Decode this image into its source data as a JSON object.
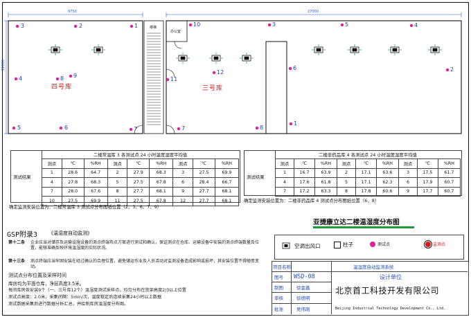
{
  "dimensions": {
    "left_width": "9750",
    "right_width": "27000",
    "height": "12000"
  },
  "rooms": {
    "room4": "四号库",
    "room3": "三号库",
    "stairs": "楼梯",
    "office": "办公室"
  },
  "points": [
    "3",
    "2",
    "1",
    "4",
    "8",
    "9",
    "5",
    "6",
    "7",
    "10",
    "3",
    "5",
    "4",
    "6",
    "11",
    "12",
    "2",
    "1",
    "8",
    "7"
  ],
  "table1": {
    "caption": "二楼常温库 3 各测试点 24 小时温度湿度平均值",
    "row_header": "测试结果",
    "headers": [
      "测点",
      "℃",
      "%RH",
      "测点",
      "℃",
      "%RH",
      "测点",
      "℃",
      "%RH"
    ],
    "rows": [
      [
        "1",
        "28.6",
        "64.7",
        "2",
        "27.9",
        "68.3",
        "3",
        "27.5",
        "69.9"
      ],
      [
        "4",
        "27.8",
        "68.3",
        "5",
        "27.5",
        "67.8",
        "6",
        "28.4",
        "66.7"
      ],
      [
        "7",
        "28.0",
        "67.6",
        "8",
        "27.7",
        "68.1",
        "9",
        "27.7",
        "68.1"
      ],
      [
        "10",
        "27.5",
        "69.9",
        "11",
        "27.5",
        "67.8",
        "12",
        "27.7",
        "68.1"
      ]
    ],
    "note": "确定监测安装位置为：二楼常温库 3 测试点分布图纸位置（2、3、6、7、9）"
  },
  "table2": {
    "caption": "二楼非药品库 4 各测试点 24 小时温度湿度平均值",
    "row_header": "测试结果",
    "headers": [
      "测点",
      "℃",
      "%RH",
      "测点",
      "℃",
      "%RH",
      "测点",
      "℃",
      "%RH"
    ],
    "rows": [
      [
        "1",
        "16.7",
        "63.9",
        "2",
        "17.1",
        "63.6",
        "3",
        "17.5",
        "61.7"
      ],
      [
        "4",
        "17.6",
        "61.8",
        "5",
        "17.1",
        "62.3",
        "6",
        "17.9",
        "60.7"
      ],
      [
        "7",
        "17.2",
        "63.3",
        "8",
        "17.8",
        "60.6",
        "9",
        "17.7",
        "60.7"
      ]
    ],
    "note": "确定监测安装位置为：二楼非药品库 4 测试点分布图纸位置（6、8）"
  },
  "drawing_title": "亚捷康立达二楼温湿度分布图",
  "gsp": {
    "title": "GSP附录3",
    "subtitle": "《温湿度自动监测》"
  },
  "clauses": [
    {
      "label": "第十二条",
      "text": "企业应当对储存及运输设施设备的测点终端布点方案进行测试和确认，保证测点在仓库、运输设备中安装的测点终端数量及位置，能够准确反映环境温湿度的实际状况。"
    },
    {
      "label": "第十三条",
      "text": "测点终端应当牢固安装在经过确认的合理位置，避免储运作业及人员活动对监测设备造成影响或损坏，其安装位置不得随意变动。"
    }
  ],
  "notes": [
    "测试点分布位置及采样时间",
    "库房均为平面仓库，净层高度3.5米。",
    "每间库房各安装9个（一、三号库12个）温湿度测试采样点，均匀分布在货架高度2/3以上位置",
    "测试点高度：2.0米，采集间隔：5min/次，温度稳定后连续采集24小时以上数据",
    "测试数据采集后进行数据分析汇总，并绘制库房温湿度分布图。"
  ],
  "legend": {
    "ac": "空调出风口",
    "column": "柱子",
    "test_point": "测试点",
    "monitor_point": "监测点"
  },
  "title_block": {
    "project_label": "项目名称",
    "project_value": "温湿度自动监测系统",
    "drawing_no_label": "图号",
    "drawing_no_value": "WSD-08",
    "design_unit_label": "设计单位",
    "designer_label": "制图",
    "designer_value": "徐金鑫",
    "checker_label": "审核",
    "checker_value": "徐德明",
    "approver_label": "批准",
    "approver_value": "",
    "date_label": "审核",
    "date_value": "吴伟刚",
    "company_cn": "北京首工科技开发有限公司",
    "company_en": "Beijing Industrial Technology Development Co., Ltd."
  },
  "colors": {
    "dim_blue": "#1a5fd6",
    "pt_magenta": "#e0209a",
    "red": "#d41a1a",
    "green": "#1e9a3a"
  }
}
